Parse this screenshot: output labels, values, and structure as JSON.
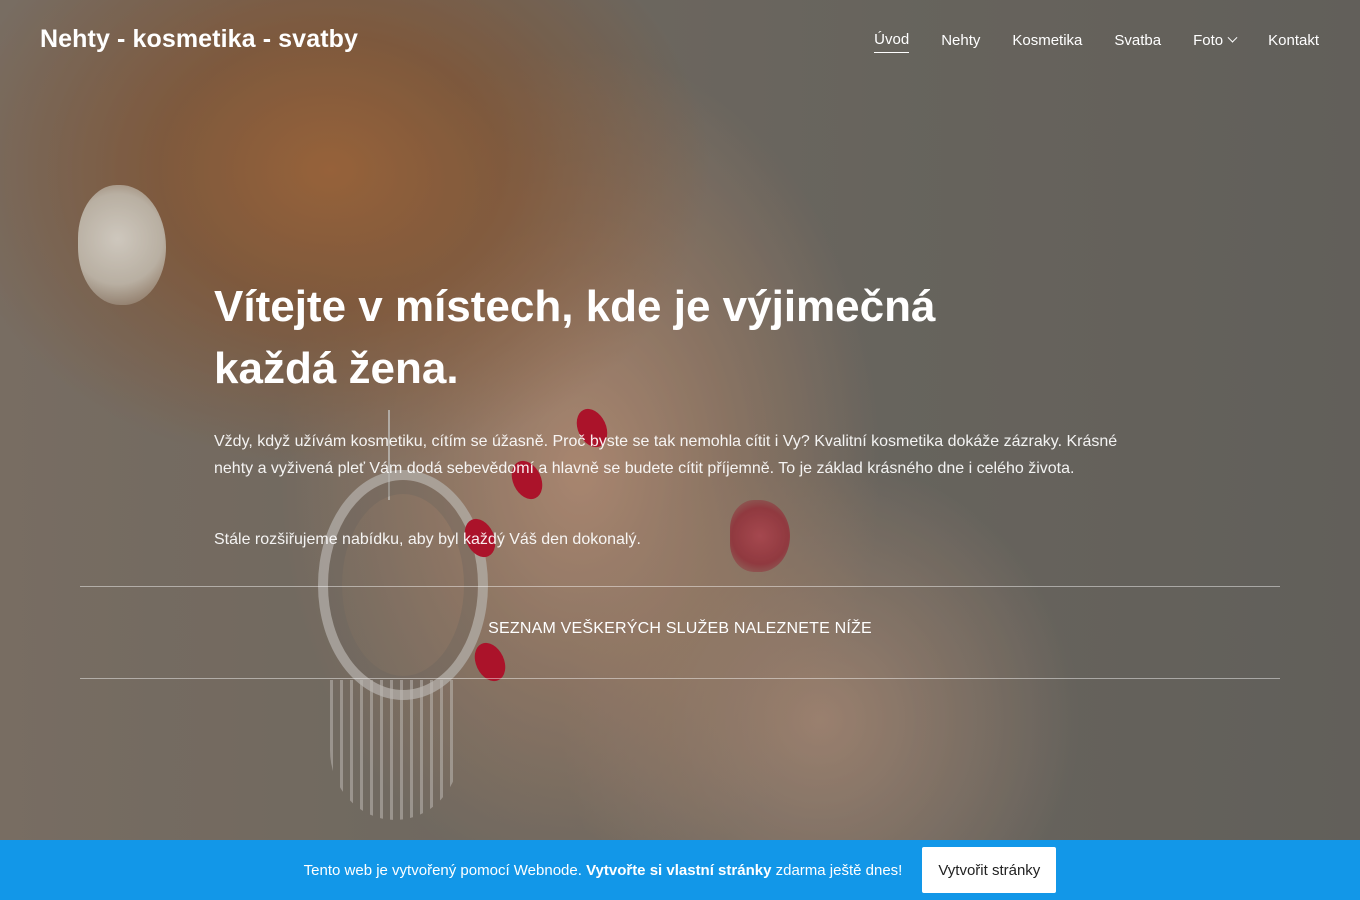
{
  "header": {
    "logo": "Nehty - kosmetika - svatby",
    "nav": [
      {
        "label": "Úvod"
      },
      {
        "label": "Nehty"
      },
      {
        "label": "Kosmetika"
      },
      {
        "label": "Svatba"
      },
      {
        "label": "Foto"
      },
      {
        "label": "Kontakt"
      }
    ]
  },
  "hero": {
    "headline_line1": "Vítejte v místech, kde je výjimečná",
    "headline_line2": "každá žena.",
    "paragraph1": "Vždy, když užívám kosmetiku, cítím se úžasně. Proč byste se tak nemohla cítit i Vy? Kvalitní kosmetika dokáže zázraky. Krásné nehty a vyživená pleť Vám dodá sebevědomí a hlavně se budete cítit příjemně. To je základ krásného dne i celého života.",
    "paragraph2": "Stále rozšiřujeme nabídku, aby byl každý Váš den dokonalý.",
    "services_label": "SEZNAM VEŠKERÝCH SLUŽEB NALEZNETE NÍŽE"
  },
  "banner": {
    "text_before": "Tento web je vytvořený pomocí Webnode.",
    "text_bold": "Vytvořte si vlastní stránky",
    "text_after": "zdarma ještě dnes!",
    "button_label": "Vytvořit stránky",
    "color": "#1297e8"
  }
}
